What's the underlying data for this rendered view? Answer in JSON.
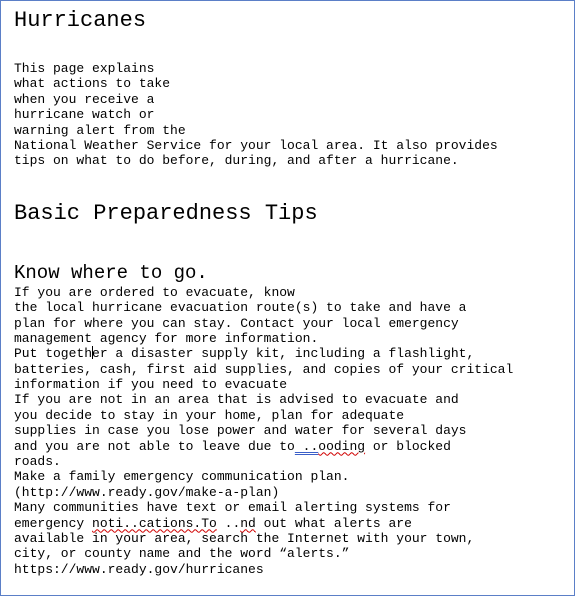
{
  "document": {
    "title": "Hurricanes",
    "intro_lines": [
      "This page explains",
      "what actions to take",
      "when you receive a",
      "hurricane watch or",
      "warning alert from the",
      "National Weather Service for your local area. It also provides",
      "tips on what to do before, during, and after a hurricane."
    ],
    "section_heading": "Basic Preparedness Tips",
    "subsection_heading": "Know where to go.",
    "body_lines": [
      "If you are ordered to evacuate, know",
      "the local hurricane evacuation route(s) to take and have a",
      "plan for where you can stay. Contact your local emergency",
      "management agency for more information."
    ],
    "kit_line_before_cursor": "Put togeth",
    "kit_line_after_cursor": "er a disaster supply kit, including a flashlight,",
    "kit_lines": [
      "batteries, cash, first aid supplies, and copies of your critical",
      "information if you need to evacuate",
      "If you are not in an area that is advised to evacuate and",
      "you decide to stay in your home, plan for adequate",
      "supplies in case you lose power and water for several days"
    ],
    "flood_line_pre": "and you are not able to leave due to",
    "flood_line_dots": " ..",
    "flood_line_word": "ooding",
    "flood_line_post": " or blocked",
    "after_flood_lines": [
      "roads.",
      "Make a family emergency communication plan.",
      "(http://www.ready.gov/make-a-plan)",
      "Many communities have text or email alerting systems for"
    ],
    "notif_pre": "emergency ",
    "notif_word1": "noti..cations.To",
    "notif_mid": " ..",
    "notif_word2": "nd",
    "notif_post": " out what alerts are",
    "final_lines": [
      "available in your area, search the Internet with your town,",
      "city, or county name and the word “alerts.”",
      "https://www.ready.gov/hurricanes"
    ]
  },
  "colors": {
    "frame_border": "#5b7fc7",
    "spell_error": "#d00000",
    "grammar_error": "#3b5fc8"
  }
}
